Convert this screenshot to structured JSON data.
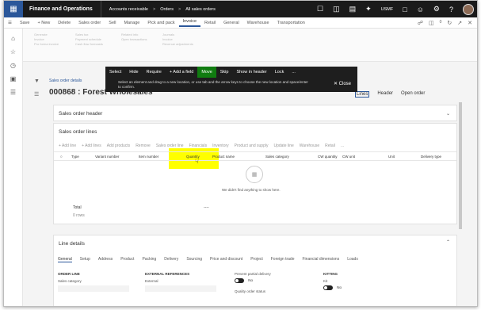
{
  "nav": {
    "brand": "Finance and Operations",
    "breadcrumbs": [
      "Accounts receivable",
      ">",
      "Orders",
      ">",
      "All sales orders"
    ],
    "company": "USMF",
    "icons": [
      "waffle-icon",
      "search-icon",
      "office-icon",
      "calendar-icon",
      "magic-icon",
      "chat-icon",
      "smile-icon",
      "gear-icon",
      "help-icon"
    ]
  },
  "actionbar": {
    "items": [
      "Save",
      "+ New",
      "Delete",
      "Sales order",
      "Sell",
      "Manage",
      "Pick and pack",
      "Invoice",
      "Retail",
      "General",
      "Warehouse",
      "Transportation"
    ],
    "active": "Invoice",
    "right_icons": [
      "attach-icon",
      "office-icon",
      "refresh-icon",
      "popout-icon",
      "close-icon"
    ],
    "notification_count": "0"
  },
  "ribbon": {
    "col1": [
      "Generate",
      "Invoice",
      "Pro forma invoice"
    ],
    "col2": [
      "Sales tax",
      "Payment schedule",
      "Cash flow forecasts"
    ],
    "col3": [
      "Related info",
      "Open transactions"
    ],
    "col4": [
      "Journals",
      "Invoice",
      "Revenue adjustments"
    ]
  },
  "overlay": {
    "tools": [
      "Select",
      "Hide",
      "Require",
      "+ Add a field",
      "Move",
      "Skip",
      "Show in header",
      "Lock",
      "..."
    ],
    "message": "Select an element and drag to a new location, or use tab and the arrow keys to choose the new location and space/enter to confirm.",
    "close": "Close"
  },
  "page": {
    "breadcrumb": "Sales order details",
    "title": "000868 : Forest Wholesales",
    "tabs": [
      "Lines",
      "Header",
      "Open order"
    ]
  },
  "sales_order_header": {
    "label": "Sales order header"
  },
  "sales_order_lines": {
    "label": "Sales order lines",
    "toolbar": [
      "+ Add line",
      "+ Add lines",
      "Add products",
      "Remove",
      "Sales order line",
      "Financials",
      "Inventory",
      "Product and supply",
      "Update line",
      "Warehouse",
      "Retail",
      "..."
    ],
    "columns": [
      "Type",
      "Variant number",
      "Item number",
      "Quantity",
      "Product name",
      "Sales category",
      "CW quantity",
      "CW unit",
      "Unit",
      "Delivery type"
    ],
    "empty_message": "We didn't find anything to show here.",
    "total_label": "Total",
    "total_dash": "----",
    "rows": "0 rows"
  },
  "line_details": {
    "label": "Line details",
    "tabs": [
      "General",
      "Setup",
      "Address",
      "Product",
      "Packing",
      "Delivery",
      "Sourcing",
      "Price and discount",
      "Project",
      "Foreign trade",
      "Financial dimensions",
      "Loads"
    ],
    "groups": {
      "order_line": {
        "header": "ORDER LINE",
        "label": "Sales category"
      },
      "external_refs": {
        "header": "EXTERNAL REFERENCES",
        "label": "External"
      },
      "partial": {
        "label": "Prevent partial delivery",
        "value": "No"
      },
      "quality": {
        "label": "Quality order status"
      },
      "kitting": {
        "header": "KITTING",
        "label": "Kit",
        "value": "No"
      }
    }
  }
}
